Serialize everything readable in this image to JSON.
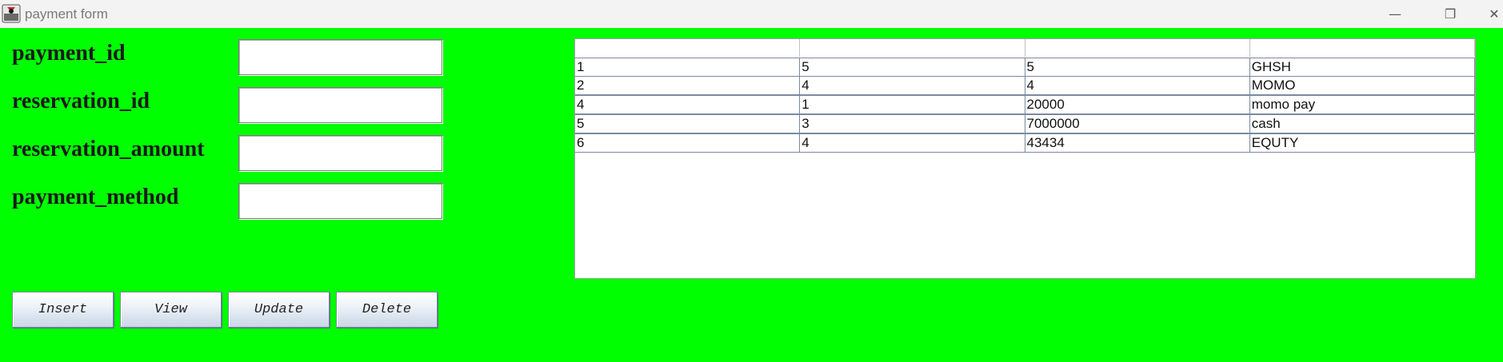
{
  "window": {
    "title": "payment form",
    "minimize_glyph": "—",
    "maximize_glyph": "❐",
    "close_glyph": "✕"
  },
  "form": {
    "fields": [
      {
        "label": "payment_id",
        "value": ""
      },
      {
        "label": "reservation_id",
        "value": ""
      },
      {
        "label": "reservation_amount",
        "value": ""
      },
      {
        "label": "payment_method",
        "value": ""
      }
    ]
  },
  "buttons": {
    "insert": "Insert",
    "view": "View",
    "update": "Update",
    "delete": "Delete"
  },
  "table": {
    "headers": [
      "",
      "",
      "",
      ""
    ],
    "rows": [
      [
        "1",
        "5",
        "5",
        "GHSH"
      ],
      [
        "2",
        "4",
        "4",
        "MOMO"
      ],
      [
        "4",
        "1",
        "20000",
        "momo pay"
      ],
      [
        "5",
        "3",
        "7000000",
        "cash"
      ],
      [
        "6",
        "4",
        "43434",
        "EQUTY"
      ]
    ]
  },
  "colors": {
    "background": "#00ff00",
    "title_bar": "#f3f3f3"
  }
}
